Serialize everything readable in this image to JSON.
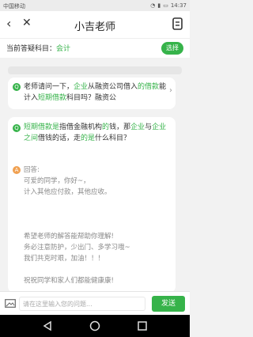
{
  "status_bar": {
    "carrier": "中国移动",
    "time": "14:37"
  },
  "header": {
    "title": "小吉老师"
  },
  "subject": {
    "label": "当前答疑科目：",
    "value": "会计",
    "button": "选择"
  },
  "history_question": {
    "badge": "Q",
    "segments": [
      {
        "t": "老师请问一下，",
        "h": false
      },
      {
        "t": "企业",
        "h": true
      },
      {
        "t": "从融资公司借入",
        "h": false
      },
      {
        "t": "的借款",
        "h": true
      },
      {
        "t": "能计入",
        "h": false
      },
      {
        "t": "短期借款",
        "h": true
      },
      {
        "t": "科目吗？融资公",
        "h": false
      }
    ]
  },
  "current_question": {
    "badge": "Q",
    "segments": [
      {
        "t": "短期借款",
        "h": true
      },
      {
        "t": "是",
        "h": true
      },
      {
        "t": "指借金融机构",
        "h": false
      },
      {
        "t": "的",
        "h": true
      },
      {
        "t": "钱，那",
        "h": false
      },
      {
        "t": "企业",
        "h": true
      },
      {
        "t": "与",
        "h": false
      },
      {
        "t": "企业之间",
        "h": true
      },
      {
        "t": "借钱的话，走",
        "h": false
      },
      {
        "t": "的是",
        "h": true
      },
      {
        "t": "什么科目？",
        "h": false
      }
    ]
  },
  "answer": {
    "badge": "A",
    "lines": [
      "回答:",
      "可爱的同学，你好~，",
      "计入其他应付款，其他应收。",
      "",
      "",
      "",
      "希望老师的解答能帮助你理解!",
      "务必注意防护，少出门、多学习哦~",
      "我们共克时艰，加油！！！",
      "",
      "祝祝同学和家人们都能健康康!"
    ]
  },
  "input": {
    "placeholder": "请在这里输入您的问题...",
    "send": "发送"
  },
  "colors": {
    "accent": "#36b34a",
    "answer_badge": "#f0a050"
  }
}
